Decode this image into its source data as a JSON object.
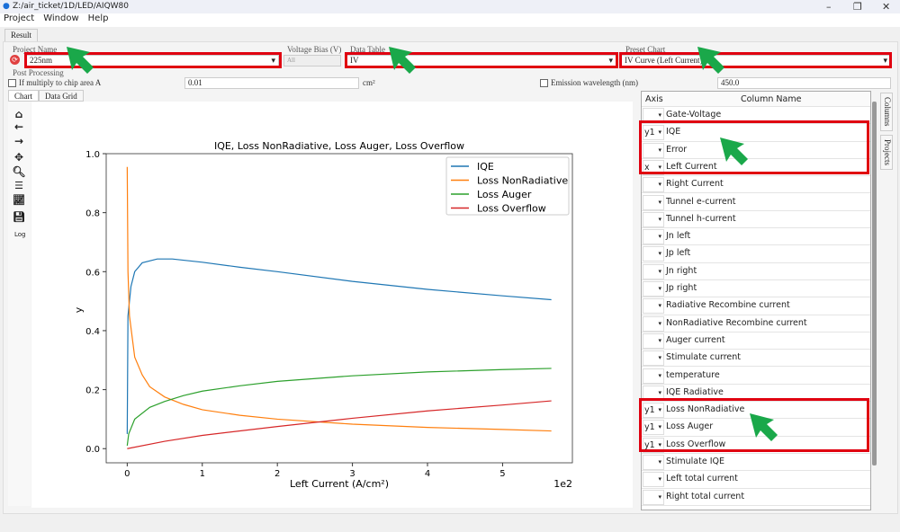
{
  "window": {
    "title": "Z:/air_ticket/1D/LED/AIQW80",
    "controls": [
      "minimize",
      "restore",
      "close"
    ]
  },
  "menu": [
    "Project",
    "Window",
    "Help"
  ],
  "main_tab": "Result",
  "controls": {
    "project_name": {
      "label": "Project Name",
      "value": "225nm"
    },
    "voltage_bias": {
      "label": "Voltage Bias (V)",
      "value": "All"
    },
    "data_table": {
      "label": "Data Table",
      "value": "IV"
    },
    "preset_chart": {
      "label": "Preset Chart",
      "value": "IV Curve (Left Current)"
    },
    "post_processing": {
      "label": "Post Processing",
      "chip_area_label": "If multiply to chip area A",
      "chip_area_value": "0.01",
      "chip_area_unit": "cm²",
      "chip_area_checked": false,
      "emission_label": "Emission wavelength (nm)",
      "emission_value": "450.0",
      "emission_checked": false
    }
  },
  "subtabs": [
    "Chart",
    "Data Grid"
  ],
  "toolbar": {
    "icons": [
      "home-icon",
      "back-icon",
      "forward-icon",
      "pan-icon",
      "zoom-icon",
      "configure-icon",
      "edit-curve-icon",
      "save-icon"
    ],
    "log_label": "Log"
  },
  "columns_table": {
    "headers": [
      "Axis",
      "Column Name"
    ],
    "rows": [
      {
        "axis": "",
        "name": "Gate-Voltage"
      },
      {
        "axis": "y1",
        "name": "IQE"
      },
      {
        "axis": "",
        "name": "Error"
      },
      {
        "axis": "x",
        "name": "Left Current"
      },
      {
        "axis": "",
        "name": "Right Current"
      },
      {
        "axis": "",
        "name": "Tunnel e-current"
      },
      {
        "axis": "",
        "name": "Tunnel h-current"
      },
      {
        "axis": "",
        "name": "Jn left"
      },
      {
        "axis": "",
        "name": "Jp left"
      },
      {
        "axis": "",
        "name": "Jn right"
      },
      {
        "axis": "",
        "name": "Jp right"
      },
      {
        "axis": "",
        "name": "Radiative Recombine current"
      },
      {
        "axis": "",
        "name": "NonRadiative Recombine current"
      },
      {
        "axis": "",
        "name": "Auger current"
      },
      {
        "axis": "",
        "name": "Stimulate current"
      },
      {
        "axis": "",
        "name": "temperature"
      },
      {
        "axis": "",
        "name": "IQE Radiative"
      },
      {
        "axis": "y1",
        "name": "Loss NonRadiative"
      },
      {
        "axis": "y1",
        "name": "Loss Auger"
      },
      {
        "axis": "y1",
        "name": "Loss Overflow"
      },
      {
        "axis": "",
        "name": "Stimulate IQE"
      },
      {
        "axis": "",
        "name": "Left total current"
      },
      {
        "axis": "",
        "name": "Right total current"
      }
    ]
  },
  "side_tabs": [
    "Columns",
    "Projects"
  ],
  "chart_data": {
    "type": "line",
    "title": "IQE, Loss NonRadiative, Loss Auger, Loss Overflow",
    "xlabel": "Left Current (A/cm²)",
    "ylabel": "y",
    "x_offset_label": "1e2",
    "xlim": [
      -0.28,
      5.93
    ],
    "ylim": [
      -0.048,
      1.0
    ],
    "xticks": [
      0,
      1,
      2,
      3,
      4,
      5
    ],
    "yticks": [
      0.0,
      0.2,
      0.4,
      0.6,
      0.8,
      1.0
    ],
    "legend_position": "top-right",
    "grid": false,
    "series": [
      {
        "name": "IQE",
        "color": "#1f77b4",
        "points": [
          [
            0,
            0.05
          ],
          [
            0.01,
            0.45
          ],
          [
            0.05,
            0.55
          ],
          [
            0.1,
            0.6
          ],
          [
            0.2,
            0.63
          ],
          [
            0.4,
            0.643
          ],
          [
            0.6,
            0.643
          ],
          [
            1,
            0.632
          ],
          [
            1.5,
            0.615
          ],
          [
            2,
            0.6
          ],
          [
            3,
            0.567
          ],
          [
            4,
            0.54
          ],
          [
            5,
            0.518
          ],
          [
            5.65,
            0.505
          ]
        ]
      },
      {
        "name": "Loss NonRadiative",
        "color": "#ff7f0e",
        "points": [
          [
            0,
            0.955
          ],
          [
            0.01,
            0.6
          ],
          [
            0.03,
            0.45
          ],
          [
            0.1,
            0.31
          ],
          [
            0.2,
            0.25
          ],
          [
            0.3,
            0.21
          ],
          [
            0.5,
            0.175
          ],
          [
            0.75,
            0.15
          ],
          [
            1,
            0.132
          ],
          [
            1.5,
            0.113
          ],
          [
            2,
            0.1
          ],
          [
            3,
            0.083
          ],
          [
            4,
            0.072
          ],
          [
            5,
            0.065
          ],
          [
            5.65,
            0.06
          ]
        ]
      },
      {
        "name": "Loss Auger",
        "color": "#2ca02c",
        "points": [
          [
            0,
            0.01
          ],
          [
            0.02,
            0.05
          ],
          [
            0.1,
            0.1
          ],
          [
            0.3,
            0.14
          ],
          [
            0.5,
            0.16
          ],
          [
            0.75,
            0.18
          ],
          [
            1,
            0.195
          ],
          [
            1.5,
            0.213
          ],
          [
            2,
            0.228
          ],
          [
            3,
            0.247
          ],
          [
            4,
            0.26
          ],
          [
            5,
            0.268
          ],
          [
            5.65,
            0.272
          ]
        ]
      },
      {
        "name": "Loss Overflow",
        "color": "#d62728",
        "points": [
          [
            0,
            0
          ],
          [
            0.5,
            0.025
          ],
          [
            1,
            0.045
          ],
          [
            2,
            0.075
          ],
          [
            3,
            0.103
          ],
          [
            4,
            0.128
          ],
          [
            5,
            0.148
          ],
          [
            5.65,
            0.162
          ]
        ]
      }
    ]
  },
  "annotation_colors": {
    "highlight": "#e00010",
    "arrow": "#1aa84a"
  }
}
